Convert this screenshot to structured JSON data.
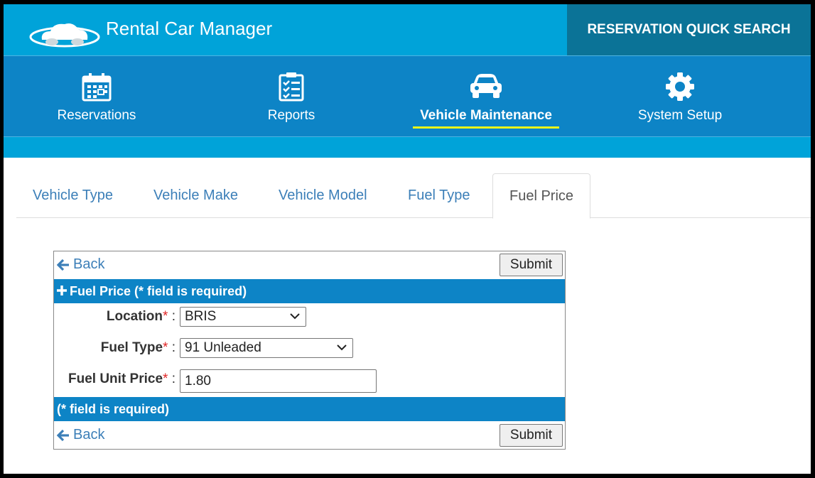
{
  "header": {
    "app_title": "Rental Car Manager",
    "quick_search_label": "RESERVATION QUICK SEARCH"
  },
  "nav": {
    "items": [
      {
        "label": "Reservations",
        "icon": "calendar-icon"
      },
      {
        "label": "Reports",
        "icon": "checklist-icon"
      },
      {
        "label": "Vehicle Maintenance",
        "icon": "car-icon",
        "active": true
      },
      {
        "label": "System Setup",
        "icon": "gear-icon"
      }
    ]
  },
  "tabs": [
    {
      "label": "Vehicle Type"
    },
    {
      "label": "Vehicle Make"
    },
    {
      "label": "Vehicle Model"
    },
    {
      "label": "Fuel Type"
    },
    {
      "label": "Fuel Price",
      "active": true
    }
  ],
  "form": {
    "back_label": "Back",
    "submit_label": "Submit",
    "section_title": "Fuel Price (* field is required)",
    "footer_note": "(* field is required)",
    "required_mark": "*",
    "separator": ":",
    "fields": {
      "location": {
        "label": "Location",
        "value": "BRIS"
      },
      "fuel_type": {
        "label": "Fuel Type",
        "value": "91 Unleaded"
      },
      "fuel_unit_price": {
        "label": "Fuel Unit Price",
        "value": "1.80"
      }
    }
  },
  "colors": {
    "header_bg": "#00a3d9",
    "nav_bg": "#0d84c6",
    "quick_search_bg": "#0b7397",
    "active_underline": "#e8f51a",
    "link": "#3c7fb8",
    "required": "#e02424"
  }
}
